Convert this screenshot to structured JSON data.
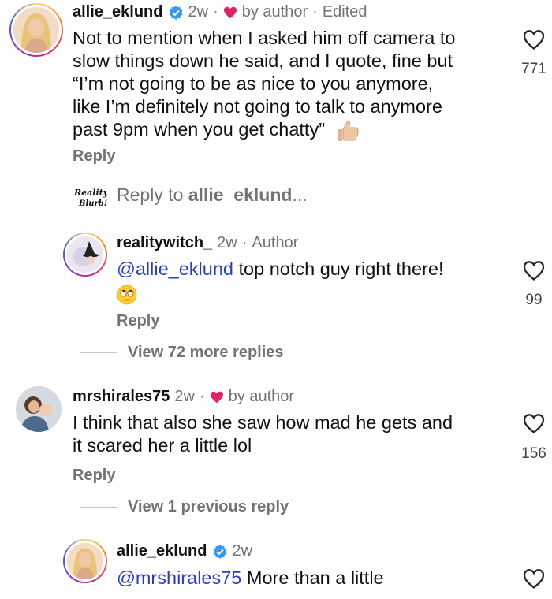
{
  "colors": {
    "mention": "#2a3ebf",
    "heart": "#e0245e",
    "verified": "#3897f0",
    "meta": "#737373"
  },
  "comments": [
    {
      "username": "allie_eklund",
      "verified": true,
      "time": "2w",
      "liked_by_author": "by author",
      "suffix": "Edited",
      "lines": [
        "Not to mention when I asked him off camera to",
        "slow things down he said, and I quote, fine but",
        "“I’m not going to be as nice to you anymore,",
        "like I’m definitely not going to talk to anymore",
        "past 9pm when you get chatty”"
      ],
      "emoji": "thumbs-up-light-skin",
      "reply_label": "Reply",
      "likes": "771"
    },
    {
      "username": "realitywitch_",
      "time": "2w",
      "role": "Author",
      "mention": "@allie_eklund",
      "text": "top notch guy right there!",
      "emoji": "face-with-rolling-eyes",
      "reply_label": "Reply",
      "likes": "99"
    },
    {
      "username": "mrshirales75",
      "time": "2w",
      "liked_by_author": "by author",
      "lines": [
        "I think that also she saw how mad he gets and",
        "it scared her a little lol"
      ],
      "reply_label": "Reply",
      "likes": "156"
    },
    {
      "username": "allie_eklund",
      "verified": true,
      "time": "2w",
      "mention": "@mrshirales75",
      "text": "More than a little"
    }
  ],
  "reply_composer": {
    "logo_text": [
      "Reality",
      "Blurb!"
    ],
    "prefix": "Reply to ",
    "target": "allie_eklund",
    "suffix": "..."
  },
  "view_more_replies": "View 72 more replies",
  "view_previous_reply": "View 1 previous reply"
}
